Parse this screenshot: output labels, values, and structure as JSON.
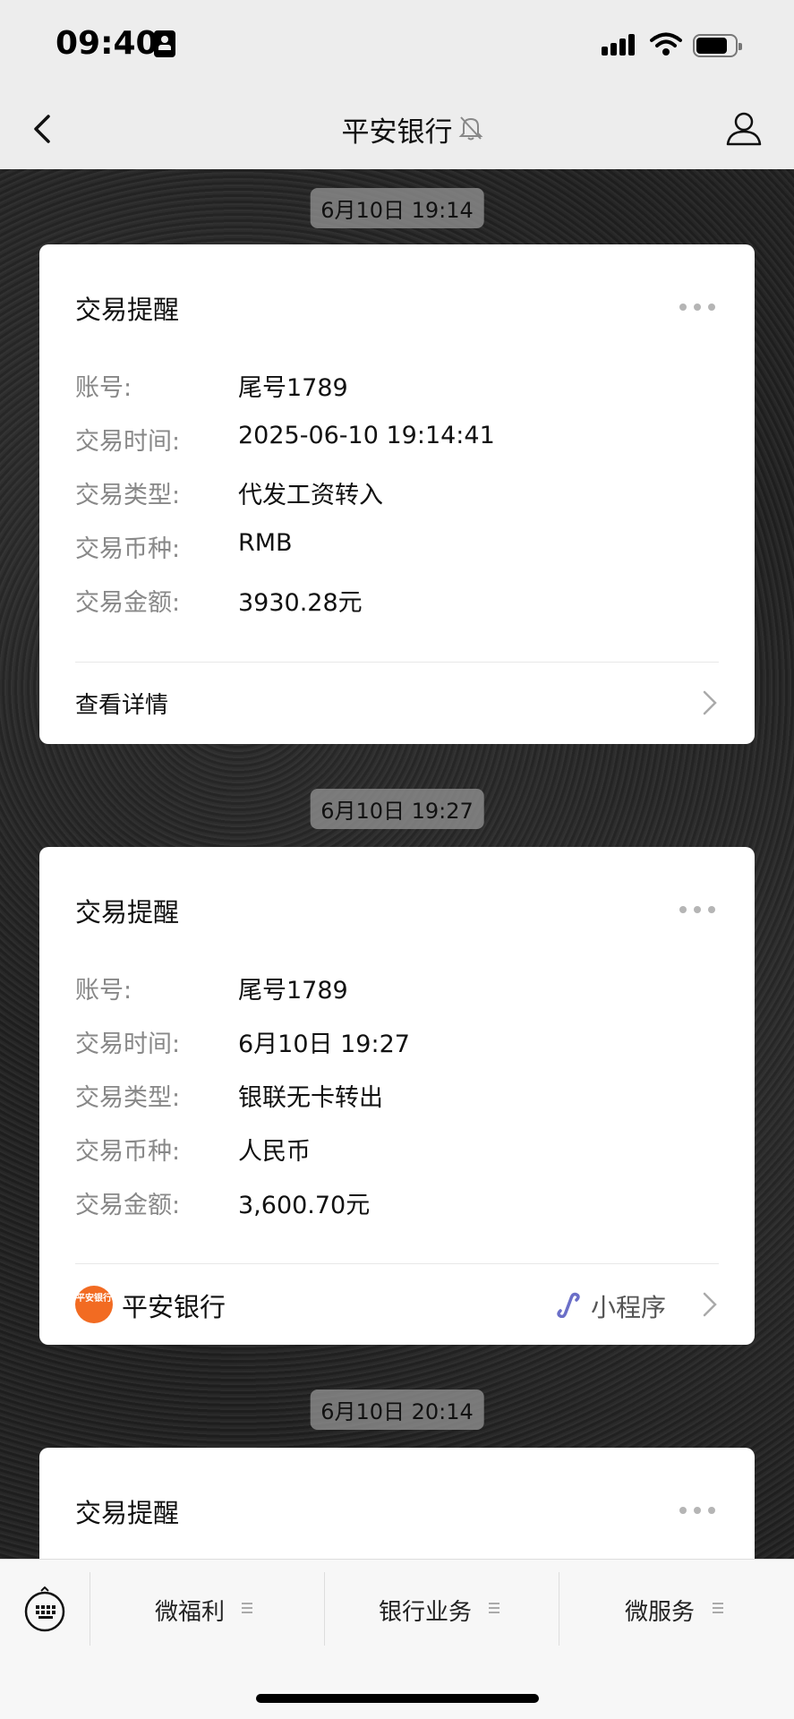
{
  "status_bar": {
    "time": "09:40"
  },
  "header": {
    "title": "平安银行"
  },
  "messages": [
    {
      "timestamp": "6月10日 19:14",
      "title": "交易提醒",
      "rows": [
        {
          "label": "账号:",
          "value": "尾号1789"
        },
        {
          "label": "交易时间:",
          "value": "2025-06-10 19:14:41"
        },
        {
          "label": "交易类型:",
          "value": "代发工资转入"
        },
        {
          "label": "交易币种:",
          "value": "RMB"
        },
        {
          "label": "交易金额:",
          "value": "3930.28元"
        }
      ],
      "footer": "查看详情"
    },
    {
      "timestamp": "6月10日 19:27",
      "title": "交易提醒",
      "rows": [
        {
          "label": "账号:",
          "value": "尾号1789"
        },
        {
          "label": "交易时间:",
          "value": "6月10日 19:27"
        },
        {
          "label": "交易类型:",
          "value": "银联无卡转出"
        },
        {
          "label": "交易币种:",
          "value": "人民币"
        },
        {
          "label": "交易金额:",
          "value": "3,600.70元"
        }
      ],
      "footer_brand": "平安银行",
      "footer_brand_logo": "平安银行",
      "footer_mini": "小程序"
    },
    {
      "timestamp": "6月10日 20:14",
      "title": "交易提醒"
    }
  ],
  "bottom_menu": [
    "微福利",
    "银行业务",
    "微服务"
  ],
  "colors": {
    "logo": "#f26b22",
    "background": "#222222",
    "card": "#ffffff"
  }
}
